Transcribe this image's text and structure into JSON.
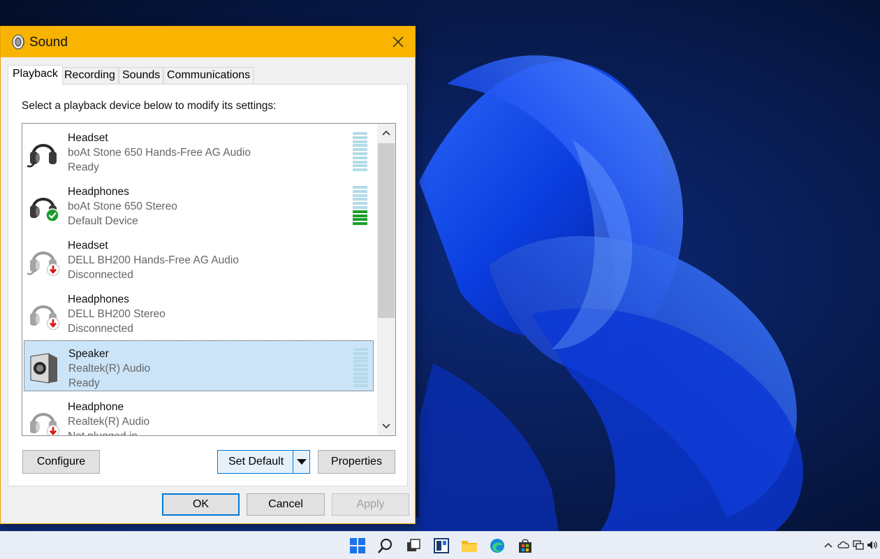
{
  "window": {
    "title": "Sound",
    "close_label": "✕"
  },
  "tabs": [
    {
      "label": "Playback",
      "active": true
    },
    {
      "label": "Recording",
      "active": false
    },
    {
      "label": "Sounds",
      "active": false
    },
    {
      "label": "Communications",
      "active": false
    }
  ],
  "playback": {
    "instruction": "Select a playback device below to modify its settings:",
    "devices": [
      {
        "name": "Headset",
        "description": "boAt Stone 650 Hands-Free AG Audio",
        "status": "Ready",
        "icon": "headset-icon",
        "badge": null,
        "meter_level": 0.0
      },
      {
        "name": "Headphones",
        "description": "boAt Stone 650 Stereo",
        "status": "Default Device",
        "icon": "headphones-icon",
        "badge": "default-check-badge",
        "meter_level": 0.4
      },
      {
        "name": "Headset",
        "description": "DELL BH200 Hands-Free AG Audio",
        "status": "Disconnected",
        "icon": "headset-icon",
        "badge": "disconnected-arrow-badge",
        "meter_level": null
      },
      {
        "name": "Headphones",
        "description": "DELL BH200 Stereo",
        "status": "Disconnected",
        "icon": "headphones-icon",
        "badge": "disconnected-arrow-badge",
        "meter_level": null
      },
      {
        "name": "Speaker",
        "description": "Realtek(R) Audio",
        "status": "Ready",
        "icon": "speaker-icon",
        "badge": null,
        "meter_level": 0.0,
        "selected": true
      },
      {
        "name": "Headphone",
        "description": "Realtek(R) Audio",
        "status": "Not plugged in",
        "icon": "headphones-icon",
        "badge": "disconnected-arrow-badge",
        "meter_level": null
      }
    ]
  },
  "buttons": {
    "configure": "Configure",
    "set_default": "Set Default",
    "properties": "Properties",
    "ok": "OK",
    "cancel": "Cancel",
    "apply": "Apply"
  },
  "colors": {
    "titlebar": "#f8b400",
    "selection": "#cce4f7",
    "meter_idle": "#b3dbe8",
    "meter_active": "#1d9e2b",
    "accent": "#0078d7"
  },
  "taskbar": {
    "icons": [
      "start-icon",
      "search-icon",
      "task-view-icon",
      "widgets-icon",
      "file-explorer-icon",
      "edge-icon",
      "store-icon"
    ],
    "tray": [
      "chevron-up-icon",
      "onedrive-icon",
      "network-icon",
      "volume-icon"
    ]
  }
}
